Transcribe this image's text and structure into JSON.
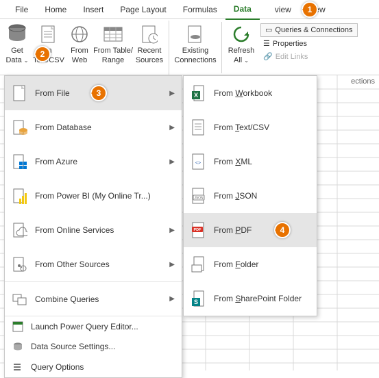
{
  "tabs": {
    "file": "File",
    "home": "Home",
    "insert": "Insert",
    "page_layout": "Page Layout",
    "formulas": "Formulas",
    "data": "Data",
    "review": "view",
    "view": "View"
  },
  "ribbon": {
    "get_data": "Get",
    "get_data2": "Data",
    "from_textcsv1": "m",
    "from_textcsv2": "Text/CSV",
    "from_web1": "From",
    "from_web2": "Web",
    "from_table1": "From Table/",
    "from_table2": "Range",
    "recent1": "Recent",
    "recent2": "Sources",
    "existing1": "Existing",
    "existing2": "Connections",
    "refresh1": "Refresh",
    "refresh2": "All",
    "queries": "Queries & Connections",
    "properties": "Properties",
    "edit_links": "Edit Links",
    "partial": "ections"
  },
  "menu1": {
    "from_file": "From File",
    "from_database": "From Database",
    "from_azure": "From Azure",
    "from_powerbi": "From Power BI (My Online Tr...)",
    "from_online": "From Online Services",
    "from_other": "From Other Sources",
    "combine": "Combine Queries",
    "launch_pq": "Launch Power Query Editor...",
    "ds_settings": "Data Source Settings...",
    "q_options": "Query Options"
  },
  "menu2": {
    "workbook_pre": "From ",
    "workbook_u": "W",
    "workbook_post": "orkbook",
    "textcsv_pre": "From ",
    "textcsv_u": "T",
    "textcsv_post": "ext/CSV",
    "xml_pre": "From ",
    "xml_u": "X",
    "xml_post": "ML",
    "json_pre": "From ",
    "json_u": "J",
    "json_post": "SON",
    "pdf_pre": "From ",
    "pdf_u": "P",
    "pdf_post": "DF",
    "folder_pre": "From ",
    "folder_u": "F",
    "folder_post": "older",
    "sp_pre": "From ",
    "sp_u": "S",
    "sp_post": "harePoint Folder"
  },
  "annotations": {
    "a1": "1",
    "a2": "2",
    "a3": "3",
    "a4": "4"
  }
}
